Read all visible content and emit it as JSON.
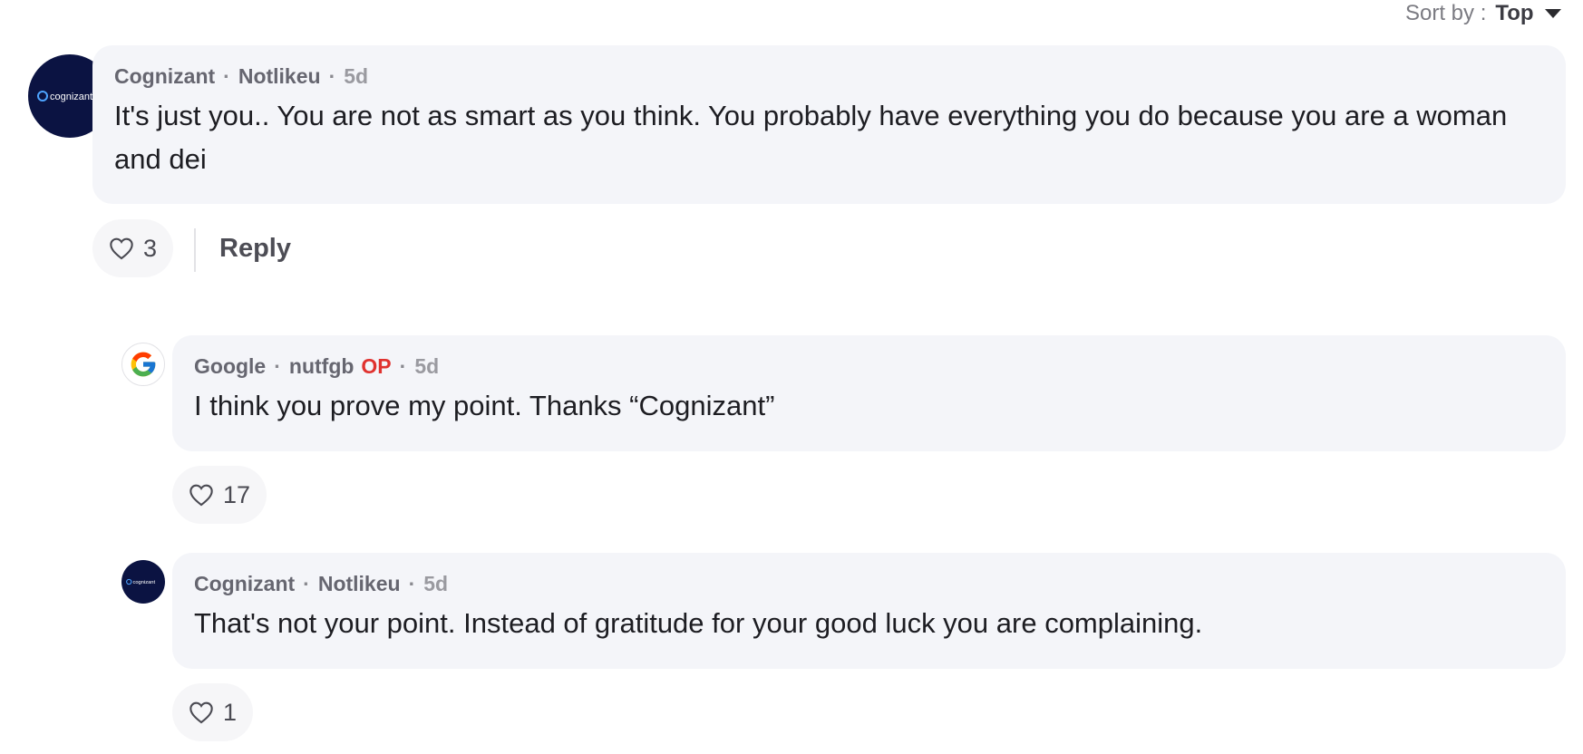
{
  "sort": {
    "label": "Sort by :",
    "value": "Top"
  },
  "colors": {
    "op": "#e0322f",
    "bubble": "#f4f5f9",
    "cognizant_avatar": "#0b1342"
  },
  "comments": [
    {
      "avatar_icon": "cognizant-logo-icon",
      "avatar_text": "cognizant",
      "company": "Cognizant",
      "user": "Notlikeu",
      "time": "5d",
      "text": "It's just you.. You are not as smart as you think. You probably have everything you do because you are a woman and dei",
      "likes": "3",
      "reply_label": "Reply"
    },
    {
      "avatar_icon": "google-logo-icon",
      "company": "Google",
      "user": "nutfgb",
      "op_badge": "OP",
      "time": "5d",
      "text": "I think you prove my point. Thanks “Cognizant”",
      "likes": "17"
    },
    {
      "avatar_icon": "cognizant-logo-icon",
      "avatar_text": "cognizant",
      "company": "Cognizant",
      "user": "Notlikeu",
      "time": "5d",
      "text": "That's not your point. Instead of gratitude for your good luck you are complaining.",
      "likes": "1"
    }
  ]
}
